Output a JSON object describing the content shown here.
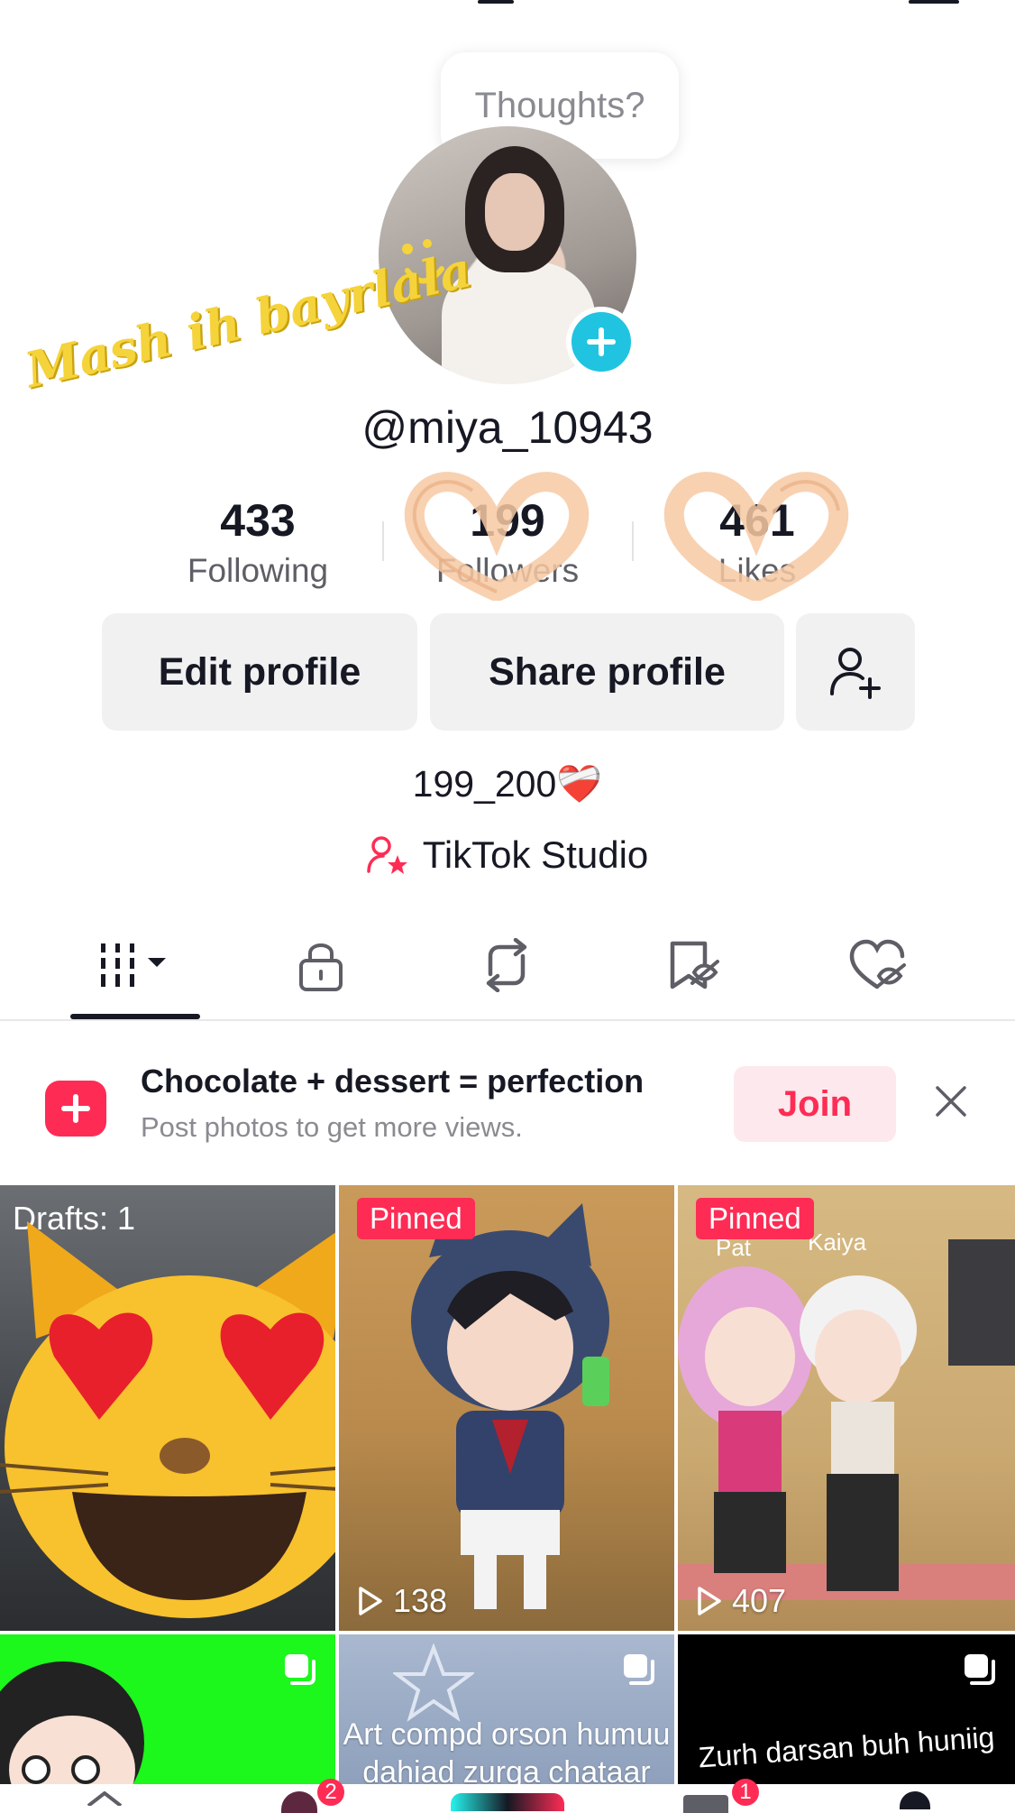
{
  "profile": {
    "bubble_text": "Thoughts?",
    "overlay_text": "Mash ih bayrlala",
    "username": "@miya_10943",
    "bio": "199_200❤️‍🩹",
    "studio_label": "TikTok Studio"
  },
  "stats": [
    {
      "value": "433",
      "label": "Following"
    },
    {
      "value": "199",
      "label": "Followers"
    },
    {
      "value": "461",
      "label": "Likes"
    }
  ],
  "buttons": {
    "edit_profile": "Edit profile",
    "share_profile": "Share profile"
  },
  "tabs": [
    {
      "name": "videos",
      "icon": "grid-icon"
    },
    {
      "name": "private",
      "icon": "lock-icon"
    },
    {
      "name": "reposts",
      "icon": "repost-icon"
    },
    {
      "name": "favorites",
      "icon": "bookmark-icon"
    },
    {
      "name": "liked",
      "icon": "heart-icon"
    }
  ],
  "banner": {
    "title": "Chocolate + dessert = perfection",
    "subtitle": "Post photos to get more views.",
    "join_label": "Join"
  },
  "grid": {
    "drafts_label": "Drafts: 1",
    "pinned_label": "Pinned",
    "video2_views": "138",
    "video3_views": "407",
    "video3_names": [
      "Pat",
      "Kaiya"
    ],
    "video5_caption": "Art compd orson humuu dahiad zurga chataar",
    "video6_caption": "Zurh darsan buh huniig"
  },
  "nav_badges": [
    "2",
    "1"
  ],
  "colors": {
    "accent": "#fe2c55",
    "avatar_badge": "#20c4e0",
    "text_primary": "#161823",
    "text_secondary": "#5e5f66"
  }
}
